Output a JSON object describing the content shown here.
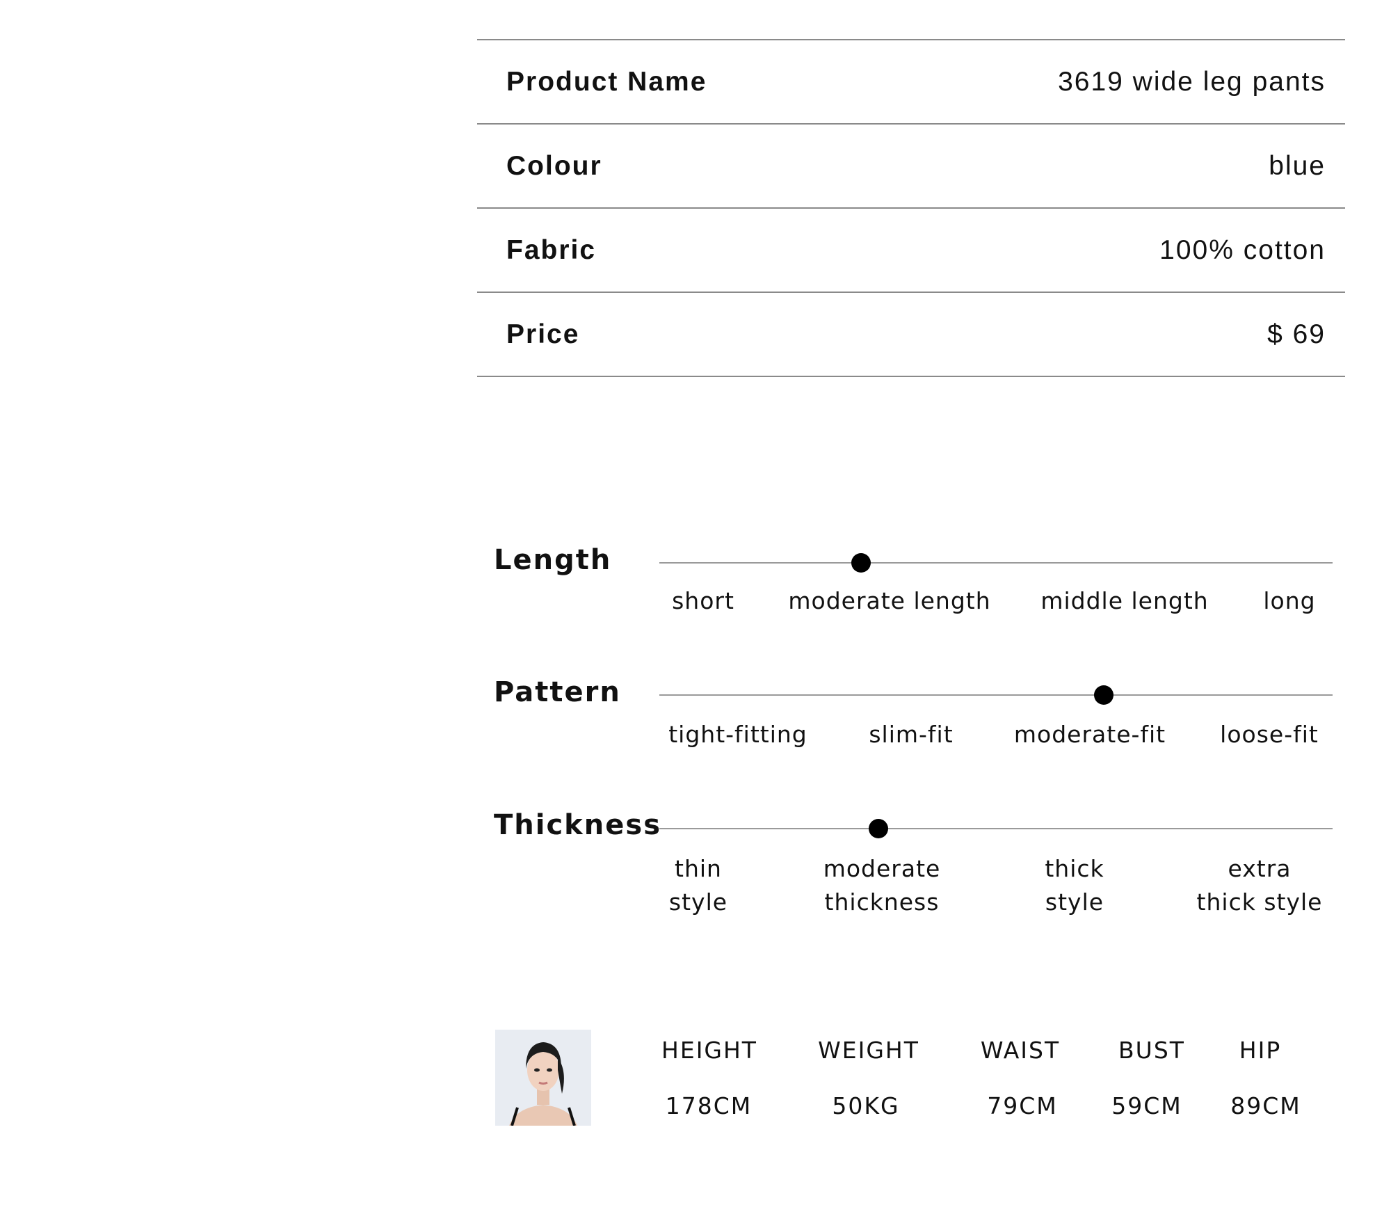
{
  "specs": [
    {
      "label": "Product Name",
      "value": "3619 wide leg pants"
    },
    {
      "label": "Colour",
      "value": "blue"
    },
    {
      "label": "Fabric",
      "value": "100% cotton"
    },
    {
      "label": "Price",
      "value": "$ 69"
    }
  ],
  "scales": [
    {
      "title": "Length",
      "options": [
        "short",
        "moderate length",
        "middle length",
        "long"
      ],
      "selected_position": 0.3
    },
    {
      "title": "Pattern",
      "options": [
        "tight-fitting",
        "slim-fit",
        "moderate-fit",
        "loose-fit"
      ],
      "selected_position": 0.66
    },
    {
      "title": "Thickness",
      "options": [
        "thin\nstyle",
        "moderate\nthickness",
        "thick\nstyle",
        "extra\nthick style"
      ],
      "selected_position": 0.325
    }
  ],
  "model": {
    "photo_icon": "model-portrait",
    "headers": [
      "HEIGHT",
      "WEIGHT",
      "WAIST",
      "BUST",
      "HIP"
    ],
    "values": [
      "178CM",
      "50KG",
      "79CM",
      "59CM",
      "89CM"
    ]
  }
}
